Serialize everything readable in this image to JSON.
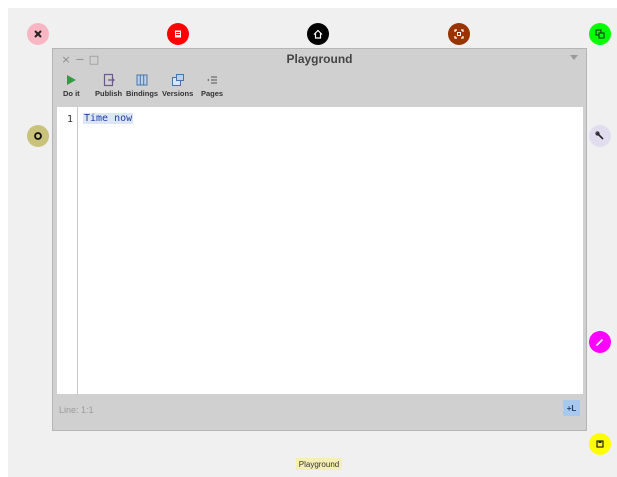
{
  "window": {
    "title": "Playground",
    "controls": {
      "close": "×",
      "minimize": "−",
      "maximize": "□"
    }
  },
  "toolbar": {
    "items": [
      {
        "label": "Do it",
        "icon": "play-icon"
      },
      {
        "label": "Publish",
        "icon": "publish-icon"
      },
      {
        "label": "Bindings",
        "icon": "bindings-icon"
      },
      {
        "label": "Versions",
        "icon": "versions-icon"
      },
      {
        "label": "Pages",
        "icon": "pages-icon"
      }
    ]
  },
  "editor": {
    "line_number": "1",
    "code": "Time now"
  },
  "status": {
    "position": "Line: 1:1",
    "toggle": "+L"
  },
  "taskbar": {
    "label": "Playground"
  },
  "halo": {
    "colors": {
      "close": "#f7b6c2",
      "menu": "#ff0000",
      "grab": "#000000",
      "drag": "#993300",
      "duplicate": "#00ff00",
      "inspect": "#e2dcef",
      "collapse": "#c9c27a",
      "recolor": "#ff00ff",
      "resize": "#ffff00"
    }
  }
}
